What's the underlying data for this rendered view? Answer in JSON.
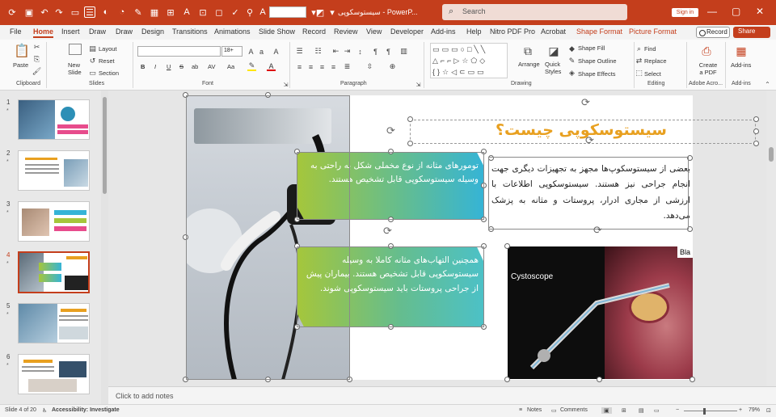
{
  "titlebar": {
    "doc_title": "سیستوسکوپی  -  PowerP...",
    "search_placeholder": "Search",
    "signin": "Sign in",
    "font_size_value": ""
  },
  "menu": {
    "items": [
      "File",
      "Home",
      "Insert",
      "Draw",
      "Draw",
      "Design",
      "Transitions",
      "Animations",
      "Slide Show",
      "Record",
      "Review",
      "View",
      "Developer",
      "Add-ins",
      "Help",
      "Nitro PDF Pro",
      "Acrobat",
      "Shape Format",
      "Picture Format"
    ],
    "active": "Home",
    "record": "Record",
    "share": "Share"
  },
  "ribbon": {
    "clipboard": {
      "label": "Clipboard",
      "paste": "Paste"
    },
    "slides": {
      "label": "Slides",
      "new_slide": "New Slide",
      "layout": "Layout",
      "reset": "Reset",
      "section": "Section"
    },
    "font": {
      "label": "Font",
      "size": "18+",
      "bold": "B",
      "italic": "I",
      "underline": "U",
      "strike": "S",
      "shadow": "ab",
      "spacing": "AV",
      "case": "Aa"
    },
    "paragraph": {
      "label": "Paragraph"
    },
    "drawing": {
      "label": "Drawing",
      "arrange": "Arrange",
      "quick_styles": "Quick Styles",
      "shape_fill": "Shape Fill",
      "shape_outline": "Shape Outline",
      "shape_effects": "Shape Effects"
    },
    "editing": {
      "label": "Editing",
      "find": "Find",
      "replace": "Replace",
      "select": "Select"
    },
    "adobe": {
      "label": "Adobe Acro...",
      "create_pdf": "Create a PDF"
    },
    "addins": {
      "label": "Add-ins",
      "addins": "Add-ins"
    }
  },
  "thumbnails": [
    {
      "num": "1",
      "star": "*"
    },
    {
      "num": "2",
      "star": "*"
    },
    {
      "num": "3",
      "star": "*"
    },
    {
      "num": "4",
      "star": "*"
    },
    {
      "num": "5",
      "star": "*"
    },
    {
      "num": "6",
      "star": "*"
    }
  ],
  "slide": {
    "title": "سیستوسکوپی چیست؟",
    "box1": "تومورهای مثانه از نوع مخملی شکل به راحتی به وسیله سیستوسکوپی قابل تشخیص هستند.",
    "box2": "همچنین التهاب‌های مثانه کاملا به وسیله سیستوسکوپی قابل تشخیص هستند. بیماران پیش از جراحی پروستات باید سیستوسکوپی شوند.",
    "body": "بعضی از سیستوسکوپ‌ها مجهز به تجهیزات دیگری جهت انجام جراحی نیز هستند. سیستوسکوپی اطلاعات با ارزشی از مجاری ادرار، پروستات و مثانه به پزشک می‌دهد.",
    "image_label": "Cystoscope",
    "image_corner": "Bla"
  },
  "notes": {
    "placeholder": "Click to add notes"
  },
  "status": {
    "slide": "Slide 4 of 20",
    "accessibility": "Accessibility: Investigate",
    "notes": "Notes",
    "comments": "Comments",
    "zoom": "79%"
  },
  "colors": {
    "accent": "#c43e1c",
    "title": "#e8a020",
    "grad_a": "#a5c63b",
    "grad_b": "#35b4d6",
    "grad_c": "#4cc1c7"
  }
}
